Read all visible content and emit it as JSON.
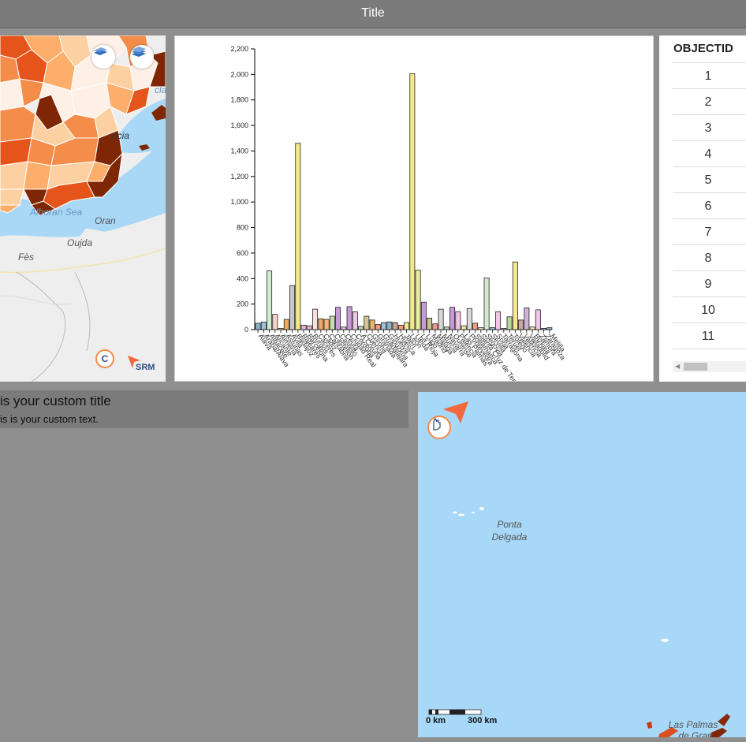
{
  "header": {
    "title": "Title"
  },
  "map_left": {
    "labels": {
      "alboran": "Alboran Sea",
      "oran": "Oran",
      "oujda": "Oujda",
      "fes": "Fès",
      "valencia": "ncia",
      "cut_top": "cla"
    },
    "buttons": [
      "basemap-toggle",
      "layers-toggle"
    ],
    "colors": {
      "choropleth": [
        "#fef0e6",
        "#fdd0a2",
        "#fdae6b",
        "#f58d4a",
        "#e5541b",
        "#b83b0c",
        "#7f2704"
      ],
      "sea": "#a9d8f6",
      "land": "#eeeeee"
    }
  },
  "chart_data": {
    "type": "bar",
    "title": "",
    "xlabel": "",
    "ylabel": "",
    "ylim": [
      0,
      2200
    ],
    "yticks": [
      "0",
      "200",
      "400",
      "600",
      "800",
      "1,000",
      "1,200",
      "1,400",
      "1,600",
      "1,800",
      "2,000",
      "2,200"
    ],
    "categories": [
      "Alava",
      "Araba/Álava",
      "Albacete",
      "Alicante",
      "Almería",
      "Asturias",
      "Ávila",
      "Badajoz",
      "Baleares",
      "Barcelona",
      "Burgos",
      "Cáceres",
      "Cádiz",
      "Cantabria",
      "Castellón",
      "Castelló",
      "Ceuta",
      "Ciudad Real",
      "Córdoba",
      "A Coruña",
      "Cuenca",
      "Girona",
      "Granada",
      "Guadalajara",
      "Gipuzkoa",
      "Huelva",
      "Huesca",
      "Jaén",
      "León",
      "Lleida",
      "La Rioja",
      "Lugo",
      "Madrid",
      "Málaga",
      "Murcia",
      "Navarra",
      "Ourense",
      "Palencia",
      "Las Palmas",
      "Pontevedra",
      "Salamanca",
      "Santa Cruz de Tenerife",
      "Segovia",
      "Sevilla",
      "Soria",
      "Tarragona",
      "Teruel",
      "Toledo",
      "Valencia",
      "València",
      "Valladolid",
      "Bizkaia",
      "Zamora",
      "Zaragoza",
      "Melilla"
    ],
    "values": [
      50,
      60,
      460,
      120,
      10,
      80,
      345,
      1460,
      35,
      30,
      160,
      85,
      80,
      105,
      175,
      20,
      180,
      140,
      25,
      105,
      75,
      40,
      55,
      60,
      55,
      35,
      55,
      2005,
      465,
      215,
      90,
      45,
      160,
      20,
      175,
      140,
      30,
      165,
      50,
      15,
      405,
      15,
      140,
      10,
      100,
      530,
      75,
      170,
      20,
      155,
      10,
      15
    ],
    "bar_colors": [
      "#8fb3c9",
      "#9cc1d9",
      "#d2ecd1",
      "#f5d3c9",
      "#f6e9a7",
      "#f0a95c",
      "#c8c8c8",
      "#f6e989",
      "#e8b4d4",
      "#e8b4d4",
      "#fbe0e0",
      "#f0a95c",
      "#f2b872",
      "#c7ddb0",
      "#c79ad6",
      "#e7c3ec",
      "#c79ad6",
      "#f2c6e6",
      "#b9d3ae",
      "#d7c48e",
      "#e6b36d",
      "#f29a85",
      "#9cc1d9",
      "#8fb3c9",
      "#c8a89c",
      "#f29a85",
      "#f6e989",
      "#f6e989",
      "#e9eda0",
      "#c79ad6",
      "#c7c28e",
      "#f29a85",
      "#d8d8d8",
      "#b9d3ae",
      "#c79ad6",
      "#f2c6e6",
      "#f6e9a7",
      "#d8d8d8",
      "#f29a85",
      "#e8e4a6",
      "#d2ecd1",
      "#9cc1d9",
      "#f2c6e6",
      "#c8c8c8",
      "#b8d79a",
      "#f6e989",
      "#c8a89c",
      "#d0b1d8",
      "#f6e9a7",
      "#f2c6e6",
      "#9cc1d9",
      "#8fb3c9"
    ]
  },
  "table": {
    "header": "OBJECTID",
    "rows": [
      "1",
      "2",
      "3",
      "4",
      "5",
      "6",
      "7",
      "8",
      "9",
      "10",
      "11"
    ]
  },
  "textbox": {
    "title": "is your custom title",
    "text": "is is your custom text."
  },
  "map_right": {
    "labels": {
      "ponta": "Ponta",
      "delgada": "Delgada",
      "laspalmas": "Las Palmas",
      "degran": "de Gran"
    },
    "scale": {
      "left": "0 km",
      "right": "300 km"
    }
  }
}
